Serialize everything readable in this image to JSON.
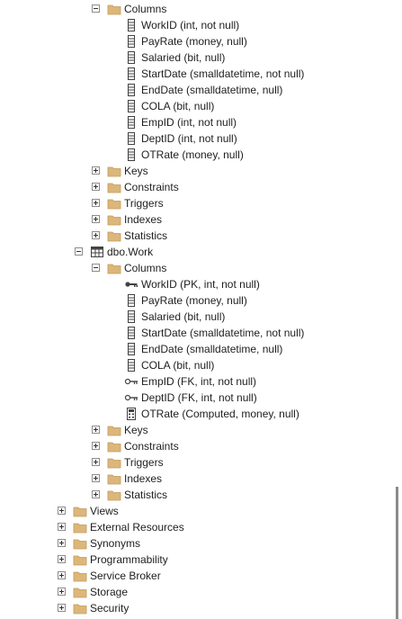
{
  "colors": {
    "folder": "#dcb67a",
    "folder_dark": "#c09a55",
    "icon_stroke": "#424242",
    "scrollbar_thumb": "#8a8a8a"
  },
  "tree": [
    {
      "level": 1,
      "expander": "minus",
      "icon": "folder-icon",
      "label": "Columns"
    },
    {
      "level": 2,
      "expander": "none",
      "icon": "column-icon",
      "label": "WorkID (int, not null)"
    },
    {
      "level": 2,
      "expander": "none",
      "icon": "column-icon",
      "label": "PayRate (money, null)"
    },
    {
      "level": 2,
      "expander": "none",
      "icon": "column-icon",
      "label": "Salaried (bit, null)"
    },
    {
      "level": 2,
      "expander": "none",
      "icon": "column-icon",
      "label": "StartDate (smalldatetime, not null)"
    },
    {
      "level": 2,
      "expander": "none",
      "icon": "column-icon",
      "label": "EndDate (smalldatetime, null)"
    },
    {
      "level": 2,
      "expander": "none",
      "icon": "column-icon",
      "label": "COLA (bit, null)"
    },
    {
      "level": 2,
      "expander": "none",
      "icon": "column-icon",
      "label": "EmpID (int, not null)"
    },
    {
      "level": 2,
      "expander": "none",
      "icon": "column-icon",
      "label": "DeptID (int, not null)"
    },
    {
      "level": 2,
      "expander": "none",
      "icon": "column-icon",
      "label": "OTRate (money, null)"
    },
    {
      "level": 1,
      "expander": "plus",
      "icon": "folder-icon",
      "label": "Keys"
    },
    {
      "level": 1,
      "expander": "plus",
      "icon": "folder-icon",
      "label": "Constraints"
    },
    {
      "level": 1,
      "expander": "plus",
      "icon": "folder-icon",
      "label": "Triggers"
    },
    {
      "level": 1,
      "expander": "plus",
      "icon": "folder-icon",
      "label": "Indexes"
    },
    {
      "level": 1,
      "expander": "plus",
      "icon": "folder-icon",
      "label": "Statistics"
    },
    {
      "level": 0,
      "expander": "minus",
      "icon": "table-icon",
      "label": "dbo.Work"
    },
    {
      "level": 1,
      "expander": "minus",
      "icon": "folder-icon",
      "label": "Columns"
    },
    {
      "level": 2,
      "expander": "none",
      "icon": "primary-key-icon",
      "label": "WorkID (PK, int, not null)"
    },
    {
      "level": 2,
      "expander": "none",
      "icon": "column-icon",
      "label": "PayRate (money, null)"
    },
    {
      "level": 2,
      "expander": "none",
      "icon": "column-icon",
      "label": "Salaried (bit, null)"
    },
    {
      "level": 2,
      "expander": "none",
      "icon": "column-icon",
      "label": "StartDate (smalldatetime, not null)"
    },
    {
      "level": 2,
      "expander": "none",
      "icon": "column-icon",
      "label": "EndDate (smalldatetime, null)"
    },
    {
      "level": 2,
      "expander": "none",
      "icon": "column-icon",
      "label": "COLA (bit, null)"
    },
    {
      "level": 2,
      "expander": "none",
      "icon": "foreign-key-icon",
      "label": "EmpID (FK, int, not null)"
    },
    {
      "level": 2,
      "expander": "none",
      "icon": "foreign-key-icon",
      "label": "DeptID (FK, int, not null)"
    },
    {
      "level": 2,
      "expander": "none",
      "icon": "computed-column-icon",
      "label": "OTRate (Computed, money, null)"
    },
    {
      "level": 1,
      "expander": "plus",
      "icon": "folder-icon",
      "label": "Keys"
    },
    {
      "level": 1,
      "expander": "plus",
      "icon": "folder-icon",
      "label": "Constraints"
    },
    {
      "level": 1,
      "expander": "plus",
      "icon": "folder-icon",
      "label": "Triggers"
    },
    {
      "level": 1,
      "expander": "plus",
      "icon": "folder-icon",
      "label": "Indexes"
    },
    {
      "level": 1,
      "expander": "plus",
      "icon": "folder-icon",
      "label": "Statistics"
    },
    {
      "level": -1,
      "expander": "plus",
      "icon": "folder-icon",
      "label": "Views"
    },
    {
      "level": -1,
      "expander": "plus",
      "icon": "folder-icon",
      "label": "External Resources"
    },
    {
      "level": -1,
      "expander": "plus",
      "icon": "folder-icon",
      "label": "Synonyms"
    },
    {
      "level": -1,
      "expander": "plus",
      "icon": "folder-icon",
      "label": "Programmability"
    },
    {
      "level": -1,
      "expander": "plus",
      "icon": "folder-icon",
      "label": "Service Broker"
    },
    {
      "level": -1,
      "expander": "plus",
      "icon": "folder-icon",
      "label": "Storage"
    },
    {
      "level": -1,
      "expander": "plus",
      "icon": "folder-icon",
      "label": "Security"
    }
  ]
}
